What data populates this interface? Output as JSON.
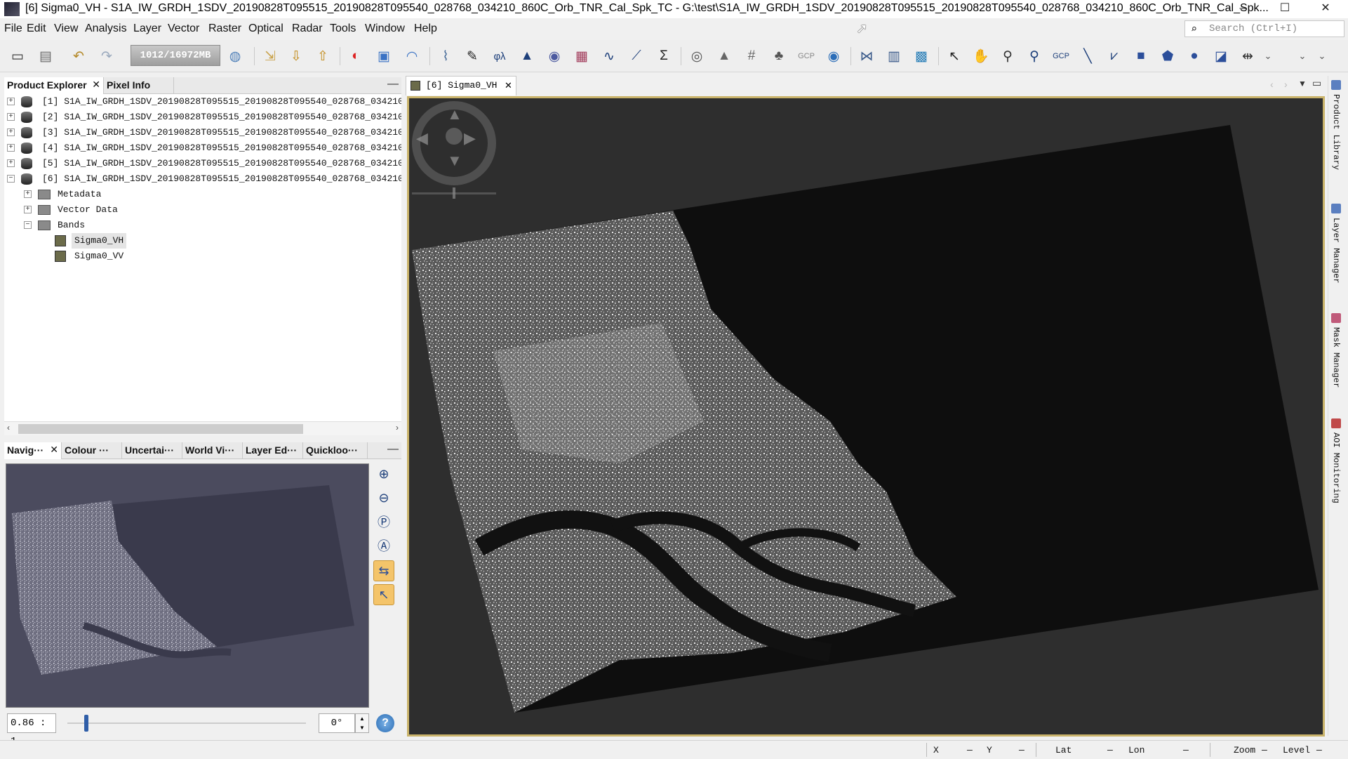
{
  "window": {
    "title": "[6] Sigma0_VH - S1A_IW_GRDH_1SDV_20190828T095515_20190828T095540_028768_034210_860C_Orb_TNR_Cal_Spk_TC - G:\\test\\S1A_IW_GRDH_1SDV_20190828T095515_20190828T095540_028768_034210_860C_Orb_TNR_Cal_Spk...",
    "minimize": "–",
    "maximize": "☐",
    "close": "✕"
  },
  "menu": [
    "File",
    "Edit",
    "View",
    "Analysis",
    "Layer",
    "Vector",
    "Raster",
    "Optical",
    "Radar",
    "Tools",
    "Window",
    "Help"
  ],
  "search": {
    "placeholder": "Search (Ctrl+I)"
  },
  "toolbar": {
    "memory": "1012/16972MB",
    "gcp_label": "GCP",
    "icons": [
      "open-product-icon",
      "save-product-icon",
      "undo-icon",
      "redo-icon",
      "memory-icon",
      "web-icon",
      "import-icon",
      "export-icon",
      "export2-icon",
      "rgb-icon",
      "layers-icon",
      "wave-icon",
      "scatter-icon",
      "band-maths-icon",
      "spectral-icon",
      "histogram-icon",
      "globe-icon",
      "map-icon",
      "profile-icon",
      "plot-icon",
      "statistics-icon",
      "sphere-icon",
      "fire-icon",
      "grid-icon",
      "tree-icon",
      "gcp-icon",
      "eye-icon",
      "graph-icon",
      "batch-icon",
      "monitor-icon",
      "select-icon",
      "pan-icon",
      "zoom-icon",
      "zoom-pixel-icon",
      "gcp-add-icon",
      "line-icon",
      "polyline-icon",
      "rectangle-icon",
      "polygon-icon",
      "ellipse-icon",
      "export-shape-icon",
      "range-icon",
      "more-icon",
      "overflow-icon",
      "overflow2-icon"
    ]
  },
  "left_panel": {
    "tabs": [
      "Product Explorer",
      "Pixel Info"
    ],
    "products": [
      "[1] S1A_IW_GRDH_1SDV_20190828T095515_20190828T095540_028768_034210_8",
      "[2] S1A_IW_GRDH_1SDV_20190828T095515_20190828T095540_028768_034210_8",
      "[3] S1A_IW_GRDH_1SDV_20190828T095515_20190828T095540_028768_034210_8",
      "[4] S1A_IW_GRDH_1SDV_20190828T095515_20190828T095540_028768_034210_8",
      "[5] S1A_IW_GRDH_1SDV_20190828T095515_20190828T095540_028768_034210_8",
      "[6] S1A_IW_GRDH_1SDV_20190828T095515_20190828T095540_028768_034210_8"
    ],
    "children": [
      "Metadata",
      "Vector Data",
      "Bands"
    ],
    "bands": [
      "Sigma0_VH",
      "Sigma0_VV"
    ],
    "selected_band": "Sigma0_VH"
  },
  "bottom_panel": {
    "tabs": [
      "Navig···",
      "Colour ···",
      "Uncertai···",
      "World Vi···",
      "Layer Ed···",
      "Quickloo···"
    ],
    "zoom_ratio": "0.86 : 1",
    "rotation": "0°",
    "help": "?",
    "slider_fraction": 0.08
  },
  "image_view": {
    "tab_label": "[6] Sigma0_VH"
  },
  "side_tabs": [
    "Product Library",
    "Layer Manager",
    "Mask Manager",
    "AOI Monitoring"
  ],
  "status": {
    "x_label": "X",
    "x_val": "—",
    "y_label": "Y",
    "y_val": "—",
    "lat_label": "Lat",
    "lat_val": "—",
    "lon_label": "Lon",
    "lon_val": "—",
    "zoom_label": "Zoom",
    "zoom_val": "—",
    "level_label": "Level",
    "level_val": "—"
  }
}
